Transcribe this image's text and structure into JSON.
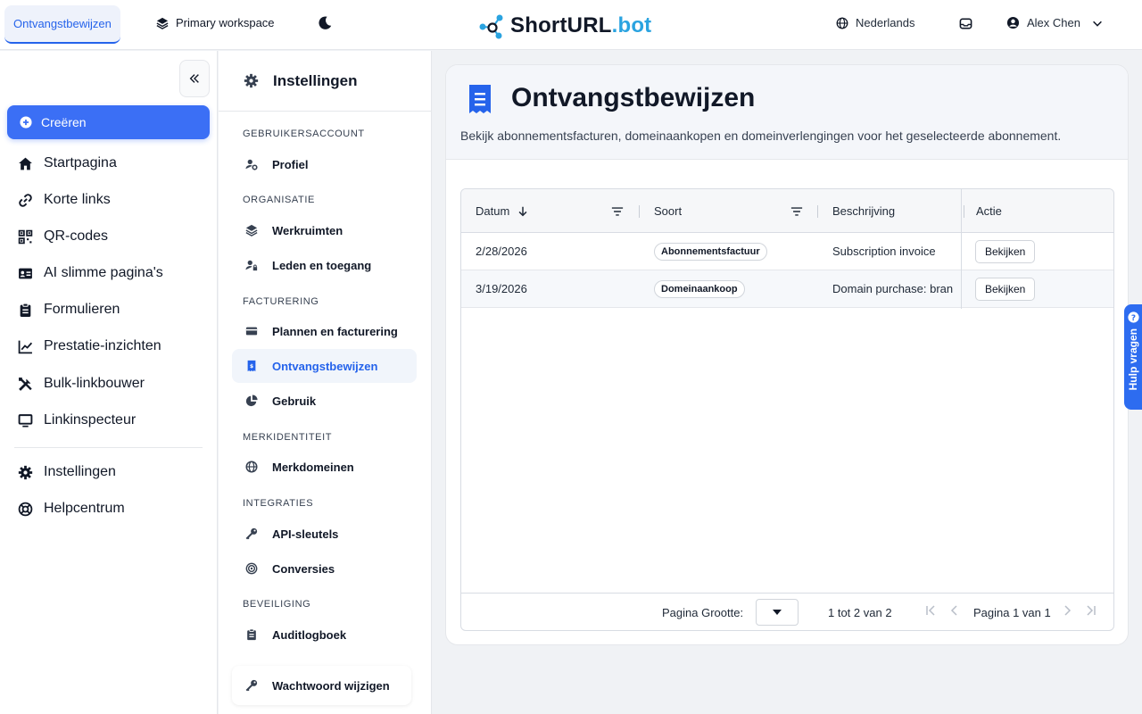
{
  "topbar": {
    "active_tab": "Ontvangstbewijzen",
    "workspace": "Primary workspace",
    "logo_part1": "ShortURL",
    "logo_part2": ".bot",
    "language": "Nederlands",
    "user_name": "Alex Chen"
  },
  "sidebar": {
    "create_label": "Creëren",
    "items": [
      {
        "label": "Startpagina",
        "icon": "home-icon"
      },
      {
        "label": "Korte links",
        "icon": "link-icon"
      },
      {
        "label": "QR-codes",
        "icon": "qr-icon"
      },
      {
        "label": "AI slimme pagina's",
        "icon": "id-card-icon"
      },
      {
        "label": "Formulieren",
        "icon": "clipboard-icon"
      },
      {
        "label": "Prestatie-inzichten",
        "icon": "chart-icon"
      },
      {
        "label": "Bulk-linkbouwer",
        "icon": "tools-icon"
      },
      {
        "label": "Linkinspecteur",
        "icon": "monitor-icon"
      }
    ],
    "bottom_items": [
      {
        "label": "Instellingen",
        "icon": "gear-icon"
      },
      {
        "label": "Helpcentrum",
        "icon": "lifebuoy-icon"
      }
    ]
  },
  "settings": {
    "title": "Instellingen",
    "sections": {
      "account": "GEBRUIKERSACCOUNT",
      "org": "ORGANISATIE",
      "billing": "FACTURERING",
      "brand": "MERKIDENTITEIT",
      "integrations": "INTEGRATIES",
      "security": "BEVEILIGING"
    },
    "items": {
      "profile": "Profiel",
      "workspaces": "Werkruimten",
      "members": "Leden en toegang",
      "plans": "Plannen en facturering",
      "receipts": "Ontvangstbewijzen",
      "usage": "Gebruik",
      "domains": "Merkdomeinen",
      "api": "API-sleutels",
      "conversions": "Conversies",
      "audit": "Auditlogboek"
    },
    "password_button": "Wachtwoord wijzigen"
  },
  "main": {
    "title": "Ontvangstbewijzen",
    "description": "Bekijk abonnementsfacturen, domeinaankopen en domeinverlengingen voor het geselecteerde abonnement.",
    "columns": {
      "date": "Datum",
      "type": "Soort",
      "description": "Beschrijving",
      "action": "Actie"
    },
    "rows": [
      {
        "date": "2/28/2026",
        "type": "Abonnementsfactuur",
        "description": "Subscription invoice",
        "action": "Bekijken"
      },
      {
        "date": "3/19/2026",
        "type": "Domeinaankoop",
        "description": "Domain purchase: bran",
        "action": "Bekijken"
      }
    ],
    "footer": {
      "page_size_label": "Pagina Grootte:",
      "range": "1 tot 2 van 2",
      "pager": "Pagina 1 van 1"
    }
  },
  "help_tab": "Hulp vragen",
  "colors": {
    "accent": "#3b6ff5",
    "logo_accent": "#2aa3e0"
  }
}
